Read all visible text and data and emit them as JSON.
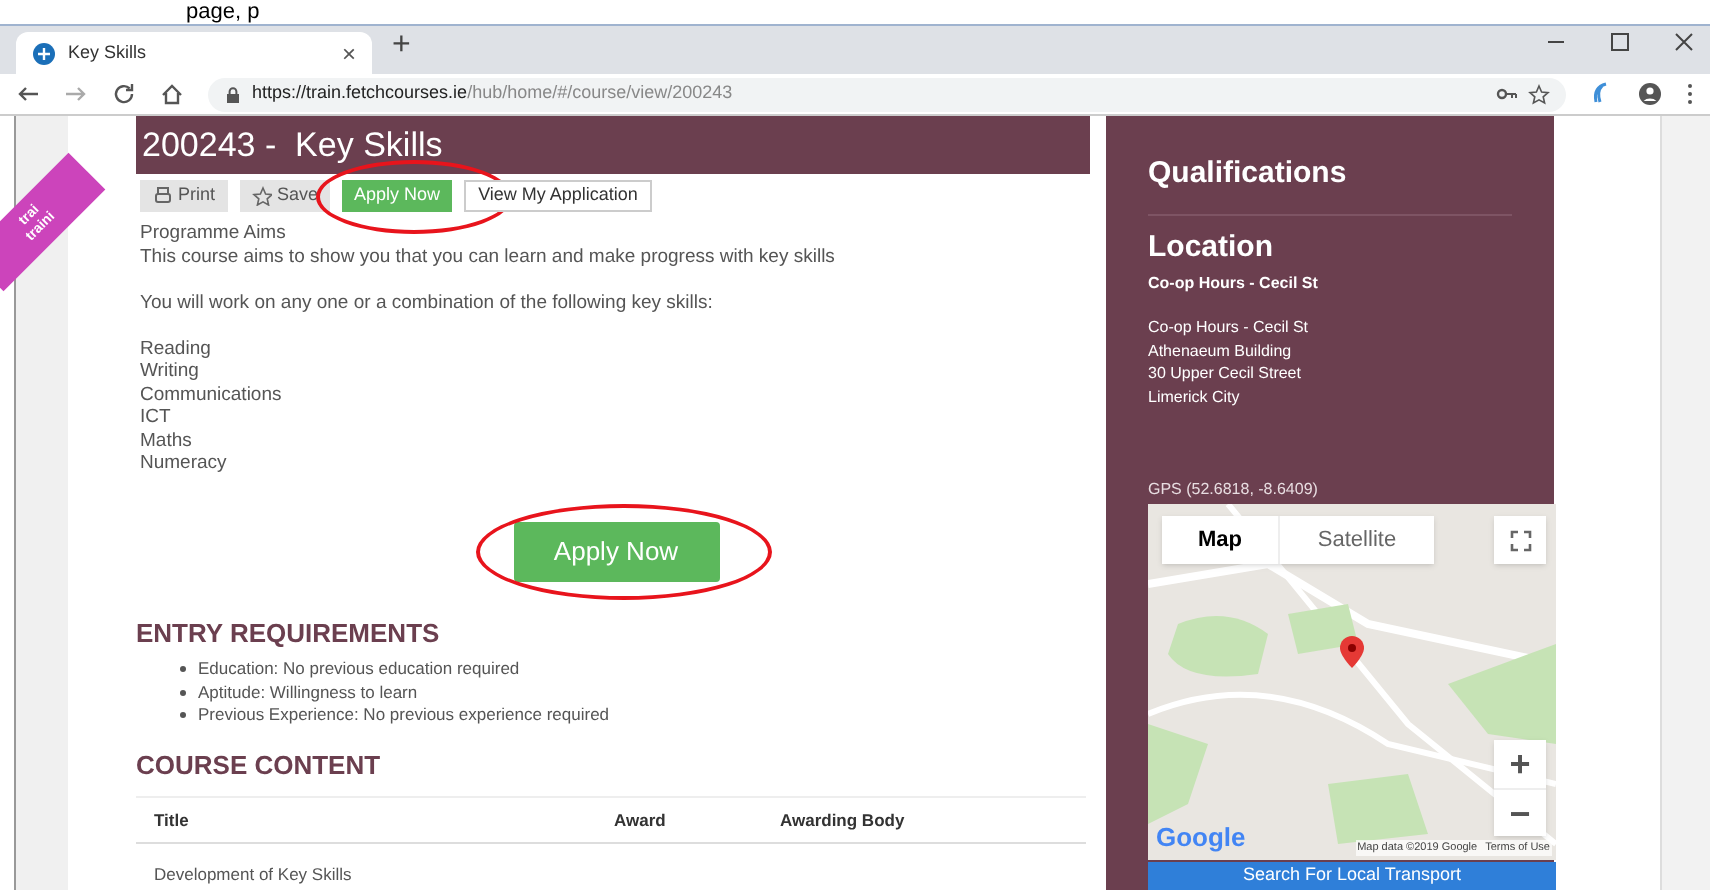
{
  "top_caption": "page, p",
  "browser": {
    "tab": {
      "title": "Key Skills",
      "close": "×"
    },
    "new_tab": "+",
    "url": {
      "host": "https://train.fetchcourses.ie",
      "path": "/hub/home/#/course/view/200243"
    }
  },
  "ribbon": [
    "trai",
    "traini"
  ],
  "course": {
    "title": "200243 -  Key Skills",
    "actions": [
      {
        "kind": "print",
        "label": "Print",
        "highlighted": false
      },
      {
        "kind": "save",
        "label": "Save",
        "highlighted": false
      },
      {
        "kind": "apply",
        "label": "Apply Now",
        "highlighted": true
      },
      {
        "kind": "plain",
        "label": "View My Application",
        "highlighted": false
      }
    ],
    "description": [
      [
        "Programme Aims",
        "This course aims to show you that you can learn and make progress with key skills"
      ],
      [
        "You will work on any one or a combination of the following key skills:"
      ],
      [
        "Reading",
        "Writing",
        "Communications",
        "ICT",
        "Maths",
        "Numeracy"
      ]
    ],
    "apply_button": {
      "label": "Apply Now",
      "highlighted": true
    },
    "entry_requirements": {
      "heading": "ENTRY REQUIREMENTS",
      "items": [
        "Education: No previous education required",
        "Aptitude: Willingness to learn",
        "Previous Experience: No previous experience required"
      ]
    },
    "course_content": {
      "heading": "COURSE CONTENT",
      "columns": [
        "Title",
        "Award",
        "Awarding Body"
      ],
      "rows": [
        [
          "Development of Key Skills",
          "",
          ""
        ]
      ]
    }
  },
  "sidebar": {
    "qualifications": "Qualifications",
    "location_heading": "Location",
    "location_name": "Co-op Hours - Cecil St",
    "address": [
      "Co-op Hours - Cecil St",
      "Athenaeum Building",
      "30 Upper Cecil Street",
      "Limerick City"
    ],
    "gps": "GPS (52.6818, -8.6409)",
    "map": {
      "tabs": [
        {
          "label": "Map",
          "selected": true
        },
        {
          "label": "Satellite",
          "selected": false
        }
      ],
      "zoom_in": "+",
      "zoom_out": "−",
      "logo": "Google",
      "attribution": "Map data ©2019 Google",
      "terms": "Terms of Use"
    },
    "transport_button": "Search For Local Transport"
  }
}
